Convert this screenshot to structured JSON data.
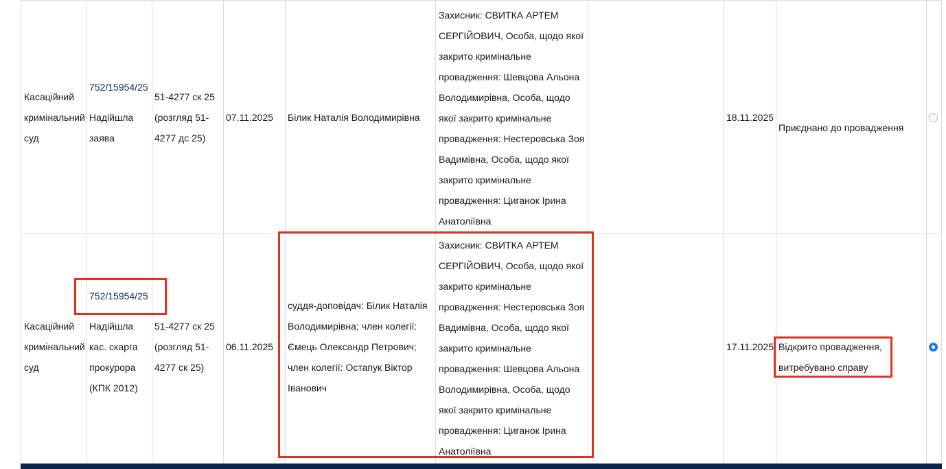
{
  "rows": [
    {
      "court": [
        "Касаційний",
        "кримінальний",
        "суд"
      ],
      "case_number": "752/15954/25",
      "doc_type": [
        "Надійшла",
        "заява"
      ],
      "proceeding": [
        "51-4277 ск 25",
        "(розгляд 51-",
        "4277 дс 25)"
      ],
      "reg_date": "07.11.2025",
      "composition": [
        "Білик Наталія Володимирівна"
      ],
      "participants": [
        "Захисник: СВИТКА АРТЕМ",
        "СЕРГІЙОВИЧ, Особа, щодо якої",
        "закрито кримінальне",
        "провадження: Шевцова Альона",
        "Володимирівна, Особа, щодо",
        "якої закрито кримінальне",
        "провадження: Нестеровська Зоя",
        "Вадимівна, Особа, щодо якої",
        "закрито кримінальне",
        "провадження: Циганок Ірина",
        "Анатоліївна"
      ],
      "decision_date": "18.11.2025",
      "status": [
        "Приєднано до провадження"
      ],
      "selected": false
    },
    {
      "court": [
        "Касаційний",
        "кримінальний",
        "суд"
      ],
      "case_number": "752/15954/25",
      "doc_type": [
        "Надійшла",
        "кас. скарга",
        "прокурора",
        "(КПК 2012)"
      ],
      "proceeding": [
        "51-4277 ск 25",
        "(розгляд 51-",
        "4277 ск 25)"
      ],
      "reg_date": "06.11.2025",
      "composition": [
        "суддя-доповідач: Білик Наталія",
        "Володимирівна; член колегії:",
        "Ємець Олександр Петрович;",
        "член колегії: Остапук Віктор",
        "Іванович"
      ],
      "participants": [
        "Захисник: СВИТКА АРТЕМ",
        "СЕРГІЙОВИЧ, Особа, щодо якої",
        "закрито кримінальне",
        "провадження: Нестеровська Зоя",
        "Вадимівна, Особа, щодо якої",
        "закрито кримінальне",
        "провадження: Шевцова Альона",
        "Володимирівна, Особа, щодо",
        "якої закрито кримінальне",
        "провадження: Циганок Ірина",
        "Анатоліївна"
      ],
      "decision_date": "17.11.2025",
      "status": [
        "Відкрито провадження,",
        "витребувано справу"
      ],
      "selected": true
    }
  ],
  "colors": {
    "highlight": "#e03222",
    "link": "#0d2a52",
    "radio_checked": "#1a7cf0",
    "bottom_bar": "#0b2447"
  }
}
